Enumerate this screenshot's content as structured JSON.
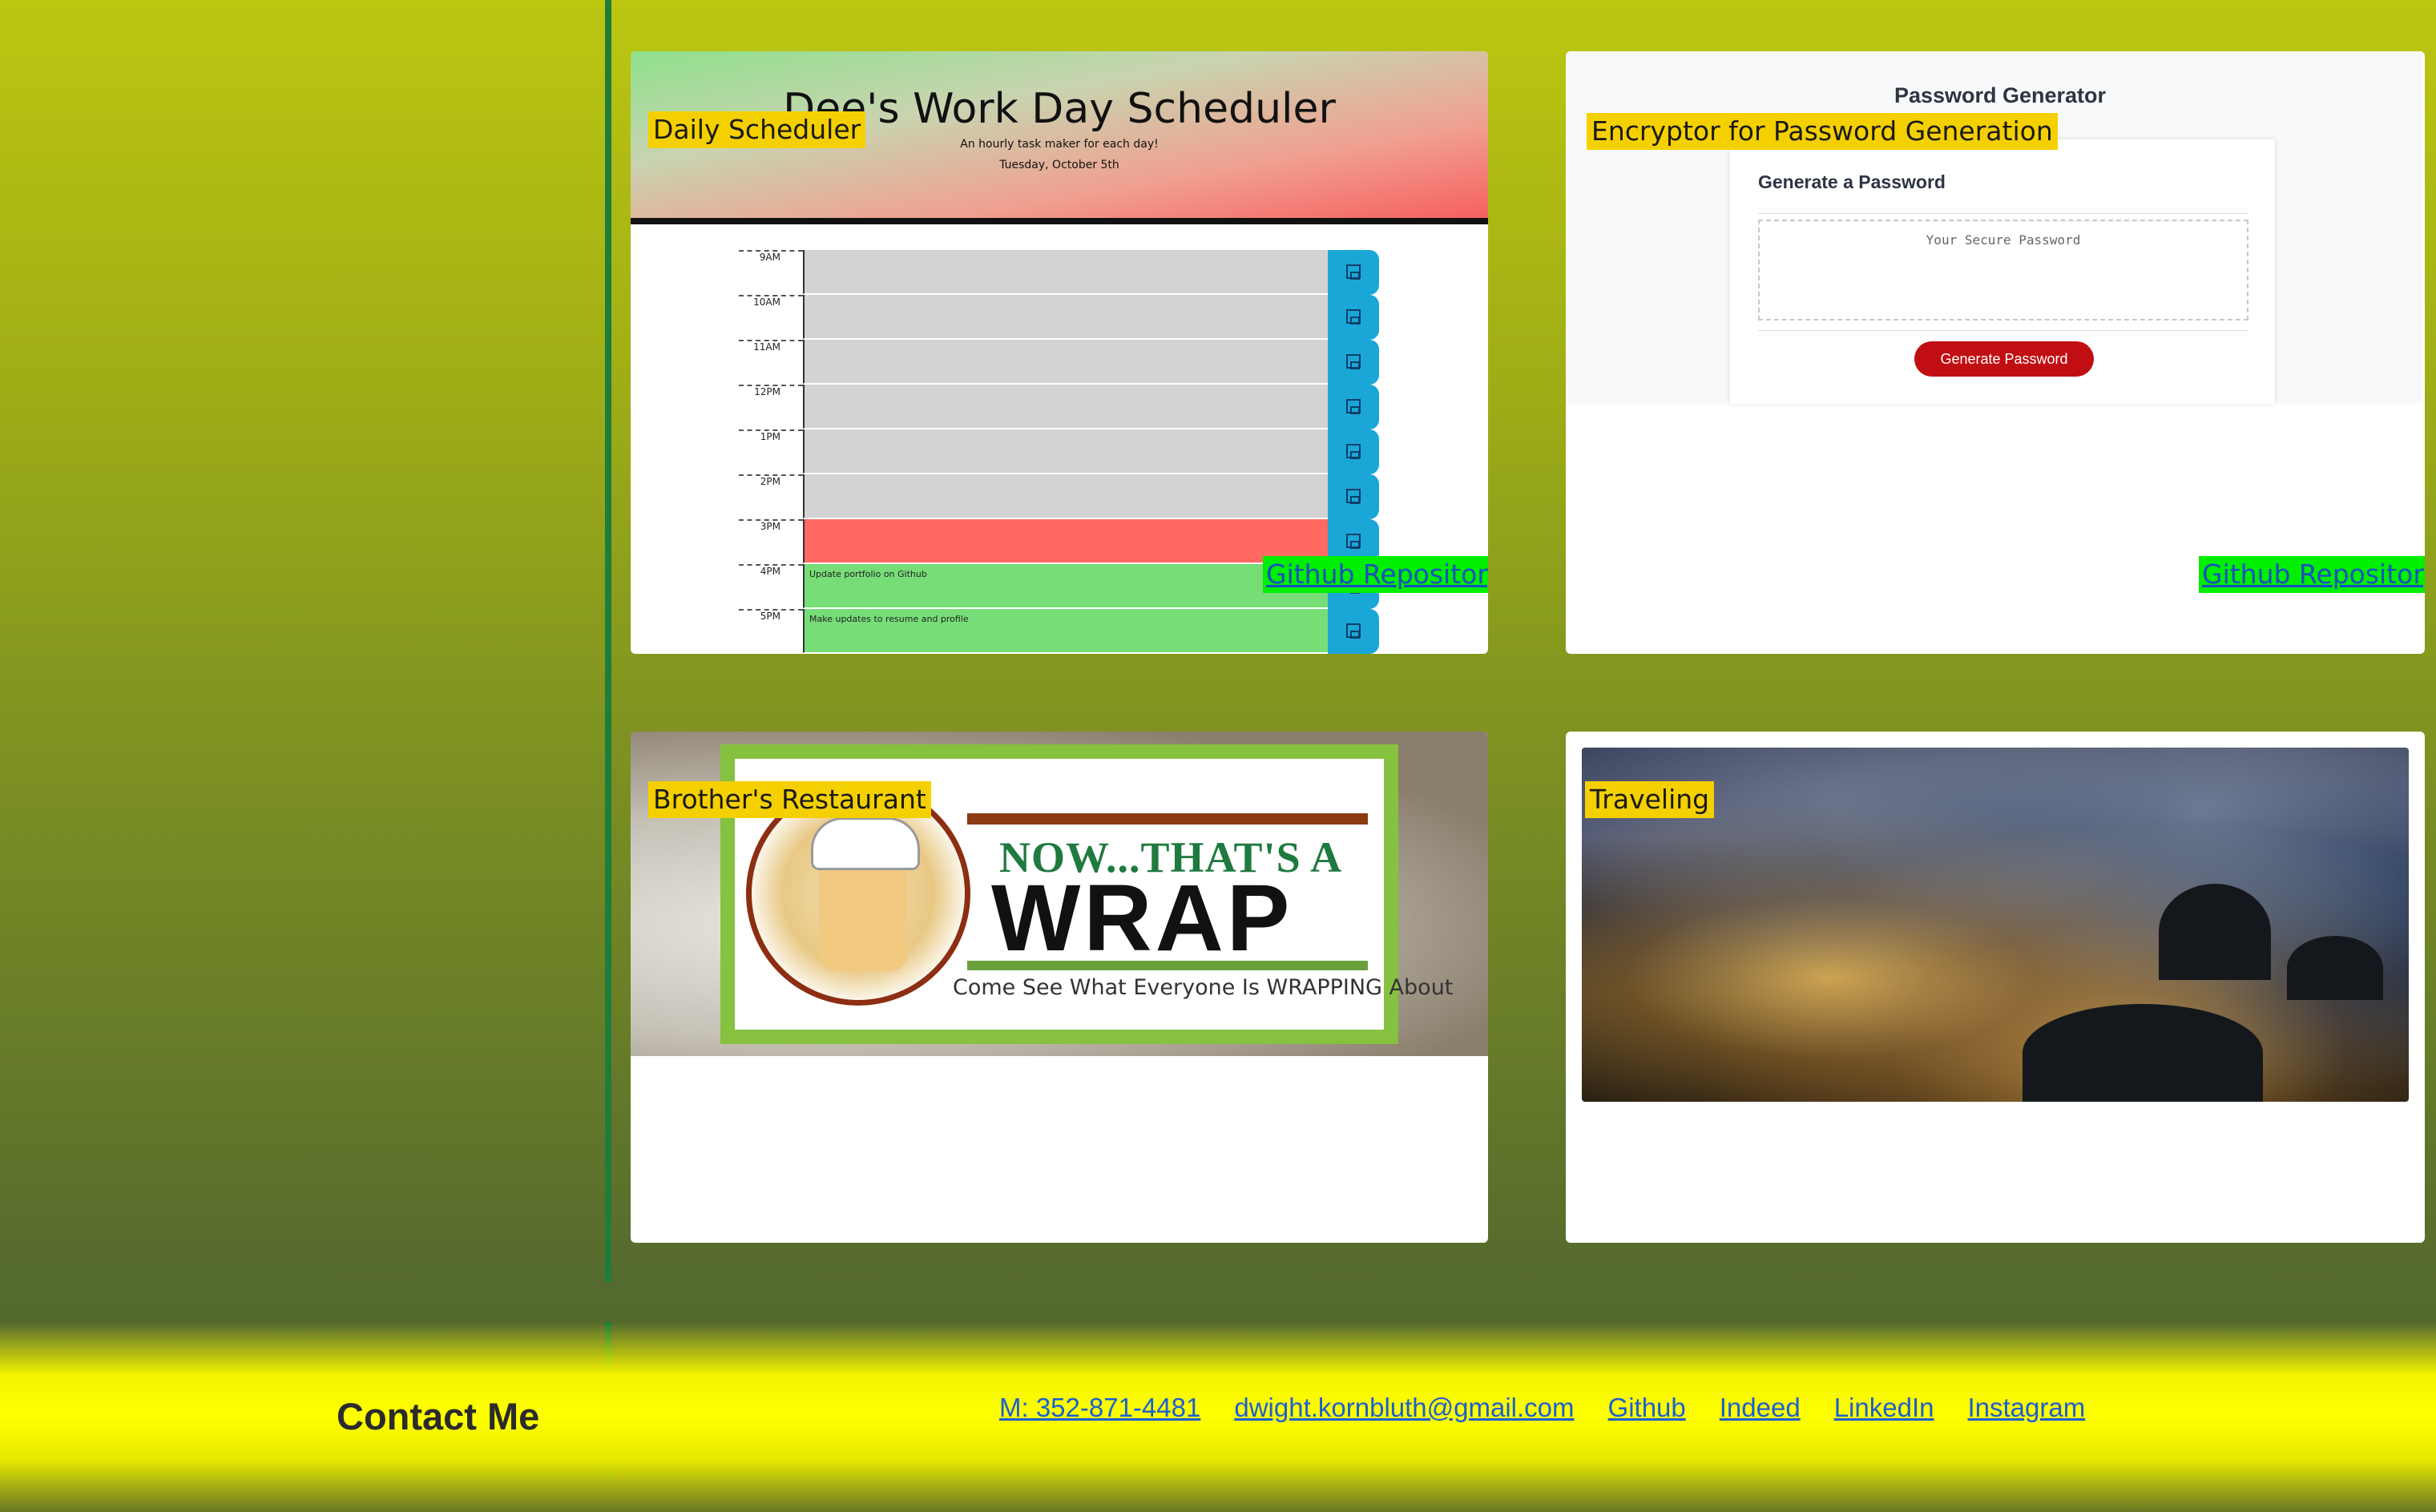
{
  "projects": [
    {
      "tag": "Daily Scheduler",
      "repo_link": "Github Repository",
      "preview": {
        "title": "Dee's Work Day Scheduler",
        "subtitle": "An hourly task maker for each day!",
        "date": "Tuesday, October 5th",
        "hours": [
          {
            "label": "9AM",
            "text": "",
            "state": "past"
          },
          {
            "label": "10AM",
            "text": "",
            "state": "past"
          },
          {
            "label": "11AM",
            "text": "",
            "state": "past"
          },
          {
            "label": "12PM",
            "text": "",
            "state": "past"
          },
          {
            "label": "1PM",
            "text": "",
            "state": "past"
          },
          {
            "label": "2PM",
            "text": "",
            "state": "past"
          },
          {
            "label": "3PM",
            "text": "",
            "state": "present"
          },
          {
            "label": "4PM",
            "text": "Update portfolio on Github",
            "state": "future"
          },
          {
            "label": "5PM",
            "text": "Make updates to resume and profile",
            "state": "future"
          }
        ]
      }
    },
    {
      "tag": "Encryptor for Password Generation",
      "repo_link": "Github Repository",
      "preview": {
        "title": "Password Generator",
        "heading": "Generate a Password",
        "placeholder": "Your Secure Password",
        "button": "Generate Password"
      }
    },
    {
      "tag": "Brother's Restaurant",
      "preview": {
        "line1": "NOW...THAT'S A",
        "line2": "WRAP",
        "tagline": "Come See What Everyone Is WRAPPING About"
      }
    },
    {
      "tag": "Traveling"
    }
  ],
  "footer": {
    "heading": "Contact Me",
    "links": [
      "M: 352-871-4481",
      "dwight.kornbluth@gmail.com",
      "Github",
      "Indeed",
      "LinkedIn",
      "Instagram"
    ]
  },
  "colors": {
    "past": "#d3d3d3",
    "present": "#ff6961",
    "future": "#77dd77",
    "tag_bg": "#f5d000",
    "repo_bg": "#00ee00"
  }
}
